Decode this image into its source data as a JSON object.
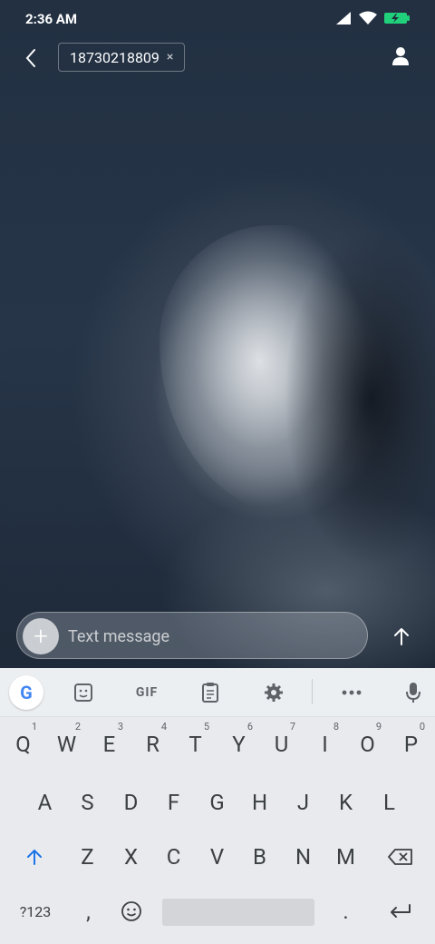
{
  "status": {
    "time": "2:36 AM",
    "icons": [
      "signal-icon",
      "wifi-icon",
      "battery-charging-icon"
    ],
    "battery_color": "#21d07a"
  },
  "header": {
    "back_icon": "chevron-left-icon",
    "recipient": "18730218809",
    "remove_symbol": "×",
    "contact_icon": "person-icon"
  },
  "composer": {
    "add_symbol": "+",
    "placeholder": "Text message",
    "value": "",
    "send_icon": "arrow-up-icon"
  },
  "keyboard": {
    "toolbar": {
      "google_letter": "G",
      "gif_label": "GIF",
      "icons": [
        "sticker-icon",
        "clipboard-icon",
        "settings-gear-icon",
        "more-icon",
        "mic-icon"
      ]
    },
    "row1": [
      {
        "key": "Q",
        "hint": "1"
      },
      {
        "key": "W",
        "hint": "2"
      },
      {
        "key": "E",
        "hint": "3"
      },
      {
        "key": "R",
        "hint": "4"
      },
      {
        "key": "T",
        "hint": "5"
      },
      {
        "key": "Y",
        "hint": "6"
      },
      {
        "key": "U",
        "hint": "7"
      },
      {
        "key": "I",
        "hint": "8"
      },
      {
        "key": "O",
        "hint": "9"
      },
      {
        "key": "P",
        "hint": "0"
      }
    ],
    "row2": [
      "A",
      "S",
      "D",
      "F",
      "G",
      "H",
      "J",
      "K",
      "L"
    ],
    "row3": [
      "Z",
      "X",
      "C",
      "V",
      "B",
      "N",
      "M"
    ],
    "row4": {
      "symbols": "?123",
      "comma": ",",
      "period": ".",
      "emoji_icon": "emoji-icon",
      "enter_icon": "enter-icon",
      "shift_icon": "shift-icon",
      "backspace_icon": "backspace-icon"
    },
    "accent_color": "#1a73e8"
  }
}
